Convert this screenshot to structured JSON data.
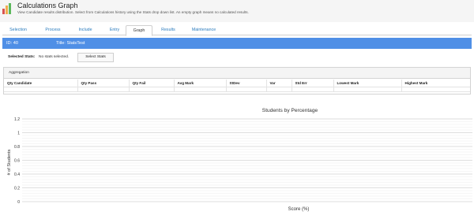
{
  "header": {
    "title": "Calculations Graph",
    "subtitle": "View Candidate results distribution. Select from Calculations history using the Stats drop down list. An empty graph means no calculated results.",
    "icon": "bar-chart-icon",
    "icon_colors": [
      "#d9534f",
      "#f0ad4e",
      "#5cb85c"
    ]
  },
  "tabs": [
    {
      "label": "Selection",
      "active": false
    },
    {
      "label": "Process",
      "active": false
    },
    {
      "label": "Include",
      "active": false
    },
    {
      "label": "Entry",
      "active": false
    },
    {
      "label": "Graph",
      "active": true
    },
    {
      "label": "Results",
      "active": false
    },
    {
      "label": "Maintenance",
      "active": false
    }
  ],
  "idbar": {
    "id": "ID: 40",
    "title": "Title: StatsTest",
    "color": "#4f8fe6"
  },
  "stats": {
    "label": "Selected Stats:",
    "value": "No stats selected.",
    "button": "Select Stats"
  },
  "aggregation": {
    "heading": "Aggregation",
    "columns": [
      "Qty Candidate",
      "Qty Pass",
      "Qty Fail",
      "Avg Mark",
      "StDev",
      "Var",
      "Std Err",
      "Lowest Mark",
      "Highest Mark"
    ]
  },
  "chart_data": {
    "type": "bar",
    "title": "Students by Percentage",
    "xlabel": "Score (%)",
    "ylabel": "# of Students",
    "categories": [],
    "values": [],
    "ylim": [
      0,
      1.2
    ],
    "yticks": [
      "0",
      "0.2",
      "0.4",
      "0.6",
      "0.8",
      "1",
      "1.2"
    ],
    "grid": true
  }
}
